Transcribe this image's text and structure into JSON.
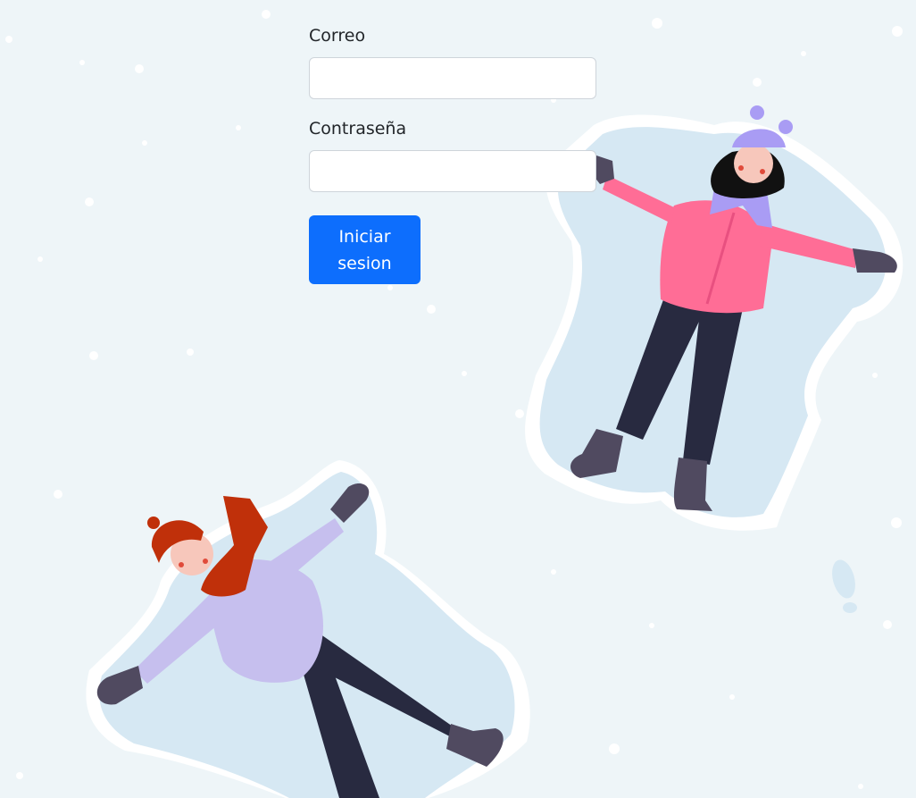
{
  "login_form": {
    "email_label": "Correo",
    "email_value": "",
    "password_label": "Contraseña",
    "password_value": "",
    "submit_label": "Iniciar sesion"
  },
  "colors": {
    "background": "#eef5f8",
    "primary_button": "#0d6efd",
    "snow_shadow": "#d6e8f3",
    "girl_jacket": "#ff6d96",
    "girl_hat_scarf": "#a99cf4",
    "boy_jacket": "#c6bfee",
    "boy_hat_scarf": "#c0300a",
    "pants": "#282a40",
    "boots_gloves": "#504a60"
  },
  "illustration": {
    "description_icon": "snow-angels-illustration"
  }
}
